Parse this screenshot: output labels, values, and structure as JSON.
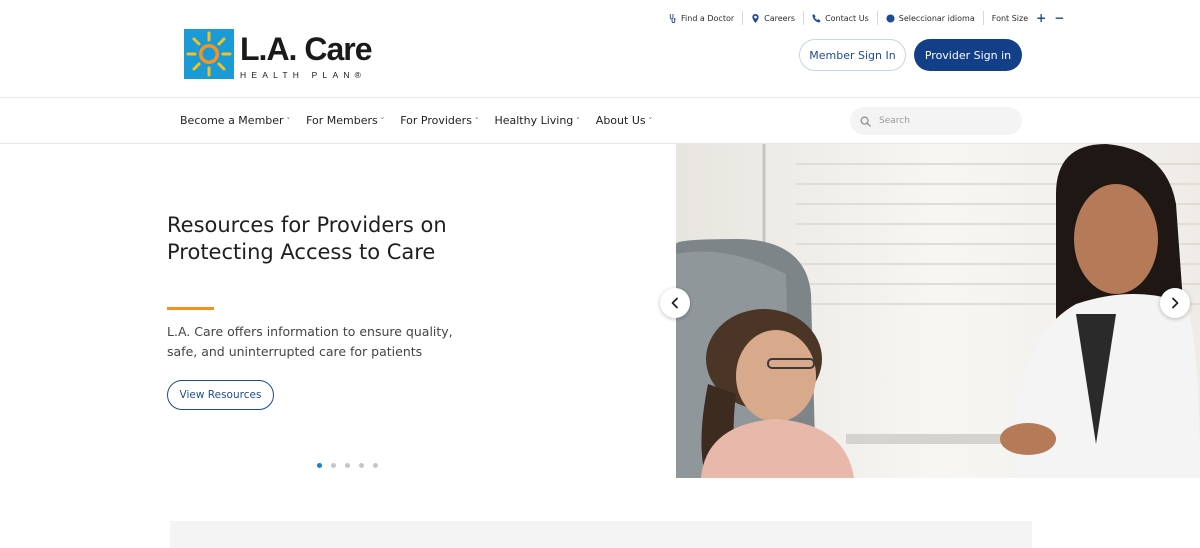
{
  "utility": {
    "find_doctor": "Find a Doctor",
    "careers": "Careers",
    "contact": "Contact Us",
    "language": "Seleccionar idioma",
    "font_size": "Font Size",
    "font_plus": "+",
    "font_minus": "−"
  },
  "logo": {
    "name": "L.A. Care",
    "subtitle": "HEALTH PLAN®"
  },
  "header": {
    "member_sign_in": "Member Sign In",
    "provider_sign_in": "Provider Sign in"
  },
  "nav": {
    "items": [
      {
        "label": "Become a Member"
      },
      {
        "label": "For Members"
      },
      {
        "label": "For Providers"
      },
      {
        "label": "Healthy Living"
      },
      {
        "label": "About Us"
      }
    ],
    "chevron": "˅"
  },
  "search": {
    "placeholder": "Search"
  },
  "hero": {
    "title": "Resources for Providers on Protecting Access to Care",
    "description": "L.A. Care offers information to ensure quality, safe, and uninterrupted care for patients",
    "button": "View Resources",
    "slide_count": 5,
    "active_slide": 1
  },
  "colors": {
    "brand_blue": "#123f87",
    "link_blue": "#1e4b93",
    "accent_orange": "#f2911b",
    "logo_blue": "#1a9ad6",
    "active_dot": "#1a7fd0"
  },
  "icons": {
    "find_doctor": "stethoscope-icon",
    "careers": "location-pin-icon",
    "contact": "phone-icon",
    "language": "globe-icon",
    "search": "search-icon",
    "prev": "chevron-left-icon",
    "next": "chevron-right-icon"
  }
}
